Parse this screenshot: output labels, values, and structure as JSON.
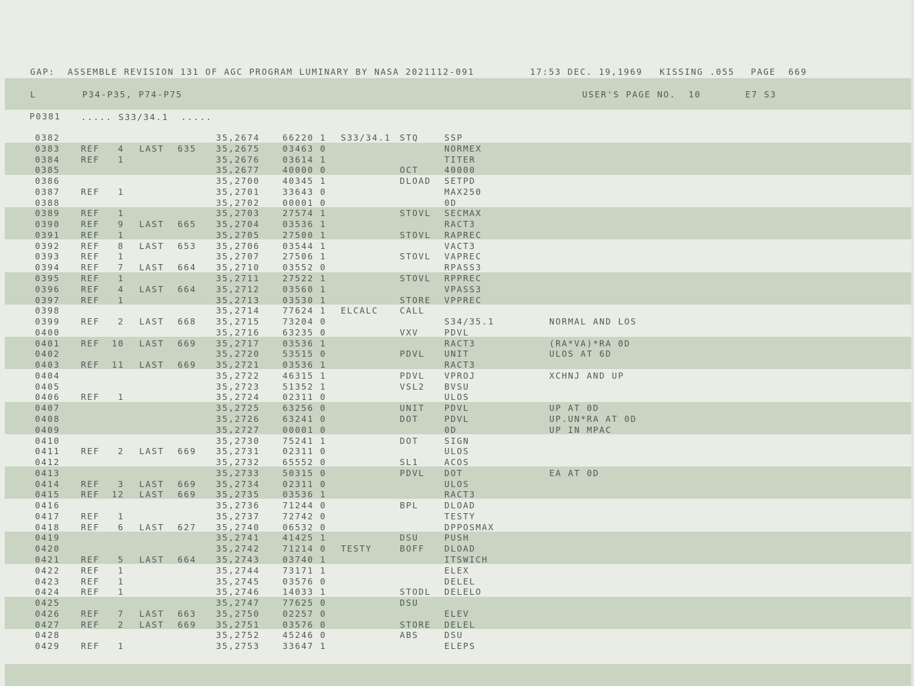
{
  "header": {
    "line": "GAP:  ASSEMBLE REVISION 131 OF AGC PROGRAM LUMINARY BY NASA 2021112-091",
    "time": "17:53 DEC. 19,1969",
    "kissing": "KISSING .055",
    "page": "PAGE  669"
  },
  "sub": {
    "l": "L",
    "title": "P34-P35, P74-P75",
    "users_page": "USER'S PAGE NO.  10",
    "e7": "E7 S3"
  },
  "proc": {
    "num": "P0381",
    "label": "..... S33/34.1  ....."
  },
  "rows": [
    {
      "line": "0382",
      "ref": "",
      "cnt": "",
      "last": "",
      "lpage": "",
      "addr": "35,2674",
      "code": "66220 1",
      "label": "S33/34.1",
      "op": "STQ",
      "operand": "SSP",
      "comment": ""
    },
    {
      "line": "0383",
      "ref": "REF",
      "cnt": "4",
      "last": "LAST",
      "lpage": "635",
      "addr": "35,2675",
      "code": "03463 0",
      "label": "",
      "op": "",
      "operand": "NORMEX",
      "comment": ""
    },
    {
      "line": "0384",
      "ref": "REF",
      "cnt": "1",
      "last": "",
      "lpage": "",
      "addr": "35,2676",
      "code": "03614 1",
      "label": "",
      "op": "",
      "operand": "TITER",
      "comment": ""
    },
    {
      "line": "0385",
      "ref": "",
      "cnt": "",
      "last": "",
      "lpage": "",
      "addr": "35,2677",
      "code": "40000 0",
      "label": "",
      "op": "OCT",
      "operand": "40000",
      "comment": ""
    },
    {
      "line": "0386",
      "ref": "",
      "cnt": "",
      "last": "",
      "lpage": "",
      "addr": "35,2700",
      "code": "40345 1",
      "label": "",
      "op": "DLOAD",
      "operand": "SETPD",
      "comment": ""
    },
    {
      "line": "0387",
      "ref": "REF",
      "cnt": "1",
      "last": "",
      "lpage": "",
      "addr": "35,2701",
      "code": "33643 0",
      "label": "",
      "op": "",
      "operand": "MAX250",
      "comment": ""
    },
    {
      "line": "0388",
      "ref": "",
      "cnt": "",
      "last": "",
      "lpage": "",
      "addr": "35,2702",
      "code": "00001 0",
      "label": "",
      "op": "",
      "operand": "0D",
      "comment": ""
    },
    {
      "line": "0389",
      "ref": "REF",
      "cnt": "1",
      "last": "",
      "lpage": "",
      "addr": "35,2703",
      "code": "27574 1",
      "label": "",
      "op": "STOVL",
      "operand": "SECMAX",
      "comment": ""
    },
    {
      "line": "0390",
      "ref": "REF",
      "cnt": "9",
      "last": "LAST",
      "lpage": "665",
      "addr": "35,2704",
      "code": "03536 1",
      "label": "",
      "op": "",
      "operand": "RACT3",
      "comment": ""
    },
    {
      "line": "0391",
      "ref": "REF",
      "cnt": "1",
      "last": "",
      "lpage": "",
      "addr": "35,2705",
      "code": "27500 1",
      "label": "",
      "op": "STOVL",
      "operand": "RAPREC",
      "comment": ""
    },
    {
      "line": "0392",
      "ref": "REF",
      "cnt": "8",
      "last": "LAST",
      "lpage": "653",
      "addr": "35,2706",
      "code": "03544 1",
      "label": "",
      "op": "",
      "operand": "VACT3",
      "comment": ""
    },
    {
      "line": "0393",
      "ref": "REF",
      "cnt": "1",
      "last": "",
      "lpage": "",
      "addr": "35,2707",
      "code": "27506 1",
      "label": "",
      "op": "STOVL",
      "operand": "VAPREC",
      "comment": ""
    },
    {
      "line": "0394",
      "ref": "REF",
      "cnt": "7",
      "last": "LAST",
      "lpage": "664",
      "addr": "35,2710",
      "code": "03552 0",
      "label": "",
      "op": "",
      "operand": "RPASS3",
      "comment": ""
    },
    {
      "line": "0395",
      "ref": "REF",
      "cnt": "1",
      "last": "",
      "lpage": "",
      "addr": "35,2711",
      "code": "27522 1",
      "label": "",
      "op": "STOVL",
      "operand": "RPPREC",
      "comment": ""
    },
    {
      "line": "0396",
      "ref": "REF",
      "cnt": "4",
      "last": "LAST",
      "lpage": "664",
      "addr": "35,2712",
      "code": "03560 1",
      "label": "",
      "op": "",
      "operand": "VPASS3",
      "comment": ""
    },
    {
      "line": "0397",
      "ref": "REF",
      "cnt": "1",
      "last": "",
      "lpage": "",
      "addr": "35,2713",
      "code": "03530 1",
      "label": "",
      "op": "STORE",
      "operand": "VPPREC",
      "comment": ""
    },
    {
      "line": "0398",
      "ref": "",
      "cnt": "",
      "last": "",
      "lpage": "",
      "addr": "35,2714",
      "code": "77624 1",
      "label": "ELCALC",
      "op": "CALL",
      "operand": "",
      "comment": ""
    },
    {
      "line": "0399",
      "ref": "REF",
      "cnt": "2",
      "last": "LAST",
      "lpage": "668",
      "addr": "35,2715",
      "code": "73204 0",
      "label": "",
      "op": "",
      "operand": "S34/35.1",
      "comment": "NORMAL AND LOS"
    },
    {
      "line": "0400",
      "ref": "",
      "cnt": "",
      "last": "",
      "lpage": "",
      "addr": "35,2716",
      "code": "63235 0",
      "label": "",
      "op": "VXV",
      "operand": "PDVL",
      "comment": ""
    },
    {
      "line": "0401",
      "ref": "REF",
      "cnt": "10",
      "last": "LAST",
      "lpage": "669",
      "addr": "35,2717",
      "code": "03536 1",
      "label": "",
      "op": "",
      "operand": "RACT3",
      "comment": "(RA*VA)*RA 0D"
    },
    {
      "line": "0402",
      "ref": "",
      "cnt": "",
      "last": "",
      "lpage": "",
      "addr": "35,2720",
      "code": "53515 0",
      "label": "",
      "op": "PDVL",
      "operand": "UNIT",
      "comment": "ULOS AT 6D"
    },
    {
      "line": "0403",
      "ref": "REF",
      "cnt": "11",
      "last": "LAST",
      "lpage": "669",
      "addr": "35,2721",
      "code": "03536 1",
      "label": "",
      "op": "",
      "operand": "RACT3",
      "comment": ""
    },
    {
      "line": "0404",
      "ref": "",
      "cnt": "",
      "last": "",
      "lpage": "",
      "addr": "35,2722",
      "code": "46315 1",
      "label": "",
      "op": "PDVL",
      "operand": "VPROJ",
      "comment": "XCHNJ AND UP"
    },
    {
      "line": "0405",
      "ref": "",
      "cnt": "",
      "last": "",
      "lpage": "",
      "addr": "35,2723",
      "code": "51352 1",
      "label": "",
      "op": "VSL2",
      "operand": "BVSU",
      "comment": ""
    },
    {
      "line": "0406",
      "ref": "REF",
      "cnt": "1",
      "last": "",
      "lpage": "",
      "addr": "35,2724",
      "code": "02311 0",
      "label": "",
      "op": "",
      "operand": "ULOS",
      "comment": ""
    },
    {
      "line": "0407",
      "ref": "",
      "cnt": "",
      "last": "",
      "lpage": "",
      "addr": "35,2725",
      "code": "63256 0",
      "label": "",
      "op": "UNIT",
      "operand": "PDVL",
      "comment": "UP AT 0D"
    },
    {
      "line": "0408",
      "ref": "",
      "cnt": "",
      "last": "",
      "lpage": "",
      "addr": "35,2726",
      "code": "63241 0",
      "label": "",
      "op": "DOT",
      "operand": "PDVL",
      "comment": "UP.UN*RA AT 0D"
    },
    {
      "line": "0409",
      "ref": "",
      "cnt": "",
      "last": "",
      "lpage": "",
      "addr": "35,2727",
      "code": "00001 0",
      "label": "",
      "op": "",
      "operand": "0D",
      "comment": "UP IN MPAC"
    },
    {
      "line": "0410",
      "ref": "",
      "cnt": "",
      "last": "",
      "lpage": "",
      "addr": "35,2730",
      "code": "75241 1",
      "label": "",
      "op": "DOT",
      "operand": "SIGN",
      "comment": ""
    },
    {
      "line": "0411",
      "ref": "REF",
      "cnt": "2",
      "last": "LAST",
      "lpage": "669",
      "addr": "35,2731",
      "code": "02311 0",
      "label": "",
      "op": "",
      "operand": "ULOS",
      "comment": ""
    },
    {
      "line": "0412",
      "ref": "",
      "cnt": "",
      "last": "",
      "lpage": "",
      "addr": "35,2732",
      "code": "65552 0",
      "label": "",
      "op": "SL1",
      "operand": "ACOS",
      "comment": ""
    },
    {
      "line": "0413",
      "ref": "",
      "cnt": "",
      "last": "",
      "lpage": "",
      "addr": "35,2733",
      "code": "50315 0",
      "label": "",
      "op": "PDVL",
      "operand": "DOT",
      "comment": "EA AT 0D"
    },
    {
      "line": "0414",
      "ref": "REF",
      "cnt": "3",
      "last": "LAST",
      "lpage": "669",
      "addr": "35,2734",
      "code": "02311 0",
      "label": "",
      "op": "",
      "operand": "ULOS",
      "comment": ""
    },
    {
      "line": "0415",
      "ref": "REF",
      "cnt": "12",
      "last": "LAST",
      "lpage": "669",
      "addr": "35,2735",
      "code": "03536 1",
      "label": "",
      "op": "",
      "operand": "RACT3",
      "comment": ""
    },
    {
      "line": "0416",
      "ref": "",
      "cnt": "",
      "last": "",
      "lpage": "",
      "addr": "35,2736",
      "code": "71244 0",
      "label": "",
      "op": "BPL",
      "operand": "DLOAD",
      "comment": ""
    },
    {
      "line": "0417",
      "ref": "REF",
      "cnt": "1",
      "last": "",
      "lpage": "",
      "addr": "35,2737",
      "code": "72742 0",
      "label": "",
      "op": "",
      "operand": "TESTY",
      "comment": ""
    },
    {
      "line": "0418",
      "ref": "REF",
      "cnt": "6",
      "last": "LAST",
      "lpage": "627",
      "addr": "35,2740",
      "code": "06532 0",
      "label": "",
      "op": "",
      "operand": "DPPOSMAX",
      "comment": ""
    },
    {
      "line": "0419",
      "ref": "",
      "cnt": "",
      "last": "",
      "lpage": "",
      "addr": "35,2741",
      "code": "41425 1",
      "label": "",
      "op": "DSU",
      "operand": "PUSH",
      "comment": ""
    },
    {
      "line": "0420",
      "ref": "",
      "cnt": "",
      "last": "",
      "lpage": "",
      "addr": "35,2742",
      "code": "71214 0",
      "label": "TESTY",
      "op": "BOFF",
      "operand": "DLOAD",
      "comment": ""
    },
    {
      "line": "0421",
      "ref": "REF",
      "cnt": "5",
      "last": "LAST",
      "lpage": "664",
      "addr": "35,2743",
      "code": "03740 1",
      "label": "",
      "op": "",
      "operand": "ITSWICH",
      "comment": ""
    },
    {
      "line": "0422",
      "ref": "REF",
      "cnt": "1",
      "last": "",
      "lpage": "",
      "addr": "35,2744",
      "code": "73171 1",
      "label": "",
      "op": "",
      "operand": "ELEX",
      "comment": ""
    },
    {
      "line": "0423",
      "ref": "REF",
      "cnt": "1",
      "last": "",
      "lpage": "",
      "addr": "35,2745",
      "code": "03576 0",
      "label": "",
      "op": "",
      "operand": "DELEL",
      "comment": ""
    },
    {
      "line": "0424",
      "ref": "REF",
      "cnt": "1",
      "last": "",
      "lpage": "",
      "addr": "35,2746",
      "code": "14033 1",
      "label": "",
      "op": "STODL",
      "operand": "DELELO",
      "comment": ""
    },
    {
      "line": "0425",
      "ref": "",
      "cnt": "",
      "last": "",
      "lpage": "",
      "addr": "35,2747",
      "code": "77625 0",
      "label": "",
      "op": "DSU",
      "operand": "",
      "comment": ""
    },
    {
      "line": "0426",
      "ref": "REF",
      "cnt": "7",
      "last": "LAST",
      "lpage": "663",
      "addr": "35,2750",
      "code": "02257 0",
      "label": "",
      "op": "",
      "operand": "ELEV",
      "comment": ""
    },
    {
      "line": "0427",
      "ref": "REF",
      "cnt": "2",
      "last": "LAST",
      "lpage": "669",
      "addr": "35,2751",
      "code": "03576 0",
      "label": "",
      "op": "STORE",
      "operand": "DELEL",
      "comment": ""
    },
    {
      "line": "0428",
      "ref": "",
      "cnt": "",
      "last": "",
      "lpage": "",
      "addr": "35,2752",
      "code": "45246 0",
      "label": "",
      "op": "ABS",
      "operand": "DSU",
      "comment": ""
    },
    {
      "line": "0429",
      "ref": "REF",
      "cnt": "1",
      "last": "",
      "lpage": "",
      "addr": "35,2753",
      "code": "33647 1",
      "label": "",
      "op": "",
      "operand": "ELEPS",
      "comment": ""
    }
  ]
}
